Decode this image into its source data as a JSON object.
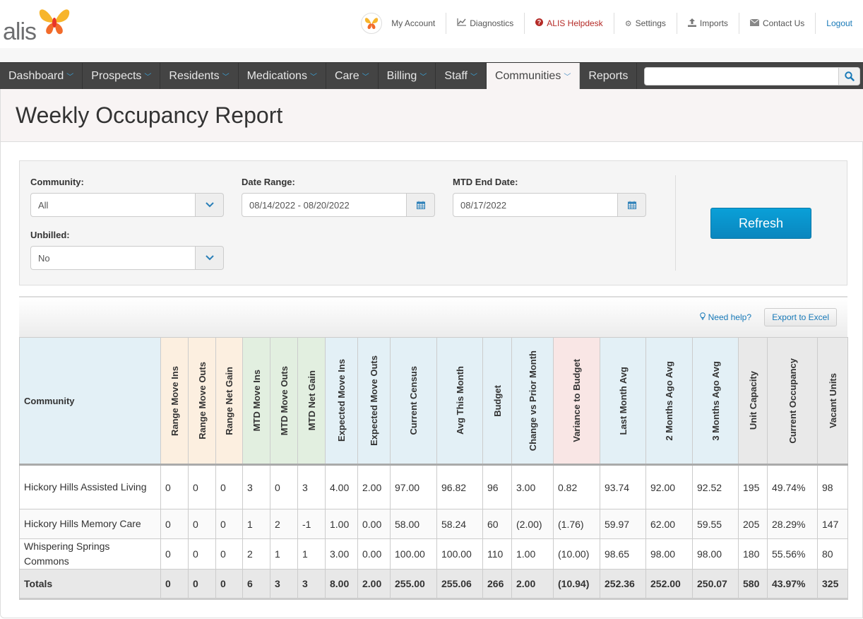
{
  "brand": {
    "logo_text": "alis"
  },
  "header": {
    "links": [
      {
        "label": "My Account",
        "icon": "avatar-icon"
      },
      {
        "label": "Diagnostics",
        "icon": "line-chart-icon"
      },
      {
        "label": "ALIS Helpdesk",
        "icon": "question-circle-icon"
      },
      {
        "label": "Settings",
        "icon": "gear-icon"
      },
      {
        "label": "Imports",
        "icon": "upload-icon"
      },
      {
        "label": "Contact Us",
        "icon": "envelope-icon"
      },
      {
        "label": "Logout"
      }
    ]
  },
  "nav": {
    "items": [
      {
        "label": "Dashboard",
        "dropdown": true
      },
      {
        "label": "Prospects",
        "dropdown": true
      },
      {
        "label": "Residents",
        "dropdown": true
      },
      {
        "label": "Medications",
        "dropdown": true
      },
      {
        "label": "Care",
        "dropdown": true
      },
      {
        "label": "Billing",
        "dropdown": true
      },
      {
        "label": "Staff",
        "dropdown": true
      },
      {
        "label": "Communities",
        "dropdown": true,
        "active": true
      },
      {
        "label": "Reports",
        "dropdown": false
      }
    ],
    "search_value": ""
  },
  "page": {
    "title": "Weekly Occupancy Report"
  },
  "filters": {
    "community": {
      "label": "Community:",
      "value": "All"
    },
    "date_range": {
      "label": "Date Range:",
      "value": "08/14/2022 - 08/20/2022"
    },
    "mtd_end_date": {
      "label": "MTD End Date:",
      "value": "08/17/2022"
    },
    "unbilled": {
      "label": "Unbilled:",
      "value": "No"
    },
    "refresh_label": "Refresh"
  },
  "tools": {
    "help_label": "Need help?",
    "export_label": "Export to Excel"
  },
  "table": {
    "columns": [
      "Community",
      "Range Move Ins",
      "Range Move Outs",
      "Range Net Gain",
      "MTD Move Ins",
      "MTD Move Outs",
      "MTD Net Gain",
      "Expected Move Ins",
      "Expected Move Outs",
      "Current Census",
      "Avg This Month",
      "Budget",
      "Change vs Prior Month",
      "Variance to Budget",
      "Last Month Avg",
      "2 Months Ago Avg",
      "3 Months Ago Avg",
      "Unit Capacity",
      "Current Occupancy",
      "Vacant Units"
    ],
    "rows": [
      [
        "Hickory Hills Assisted Living",
        "0",
        "0",
        "0",
        "3",
        "0",
        "3",
        "4.00",
        "2.00",
        "97.00",
        "96.82",
        "96",
        "3.00",
        "0.82",
        "93.74",
        "92.00",
        "92.52",
        "195",
        "49.74%",
        "98"
      ],
      [
        "Hickory Hills Memory Care",
        "0",
        "0",
        "0",
        "1",
        "2",
        "-1",
        "1.00",
        "0.00",
        "58.00",
        "58.24",
        "60",
        "(2.00)",
        "(1.76)",
        "59.97",
        "62.00",
        "59.55",
        "205",
        "28.29%",
        "147"
      ],
      [
        "Whispering Springs Commons",
        "0",
        "0",
        "0",
        "2",
        "1",
        "1",
        "3.00",
        "0.00",
        "100.00",
        "100.00",
        "110",
        "1.00",
        "(10.00)",
        "98.65",
        "98.00",
        "98.00",
        "180",
        "55.56%",
        "80"
      ]
    ],
    "totals": [
      "Totals",
      "0",
      "0",
      "0",
      "6",
      "3",
      "3",
      "8.00",
      "2.00",
      "255.00",
      "255.06",
      "266",
      "2.00",
      "(10.94)",
      "252.36",
      "252.00",
      "250.07",
      "580",
      "43.97%",
      "325"
    ]
  }
}
